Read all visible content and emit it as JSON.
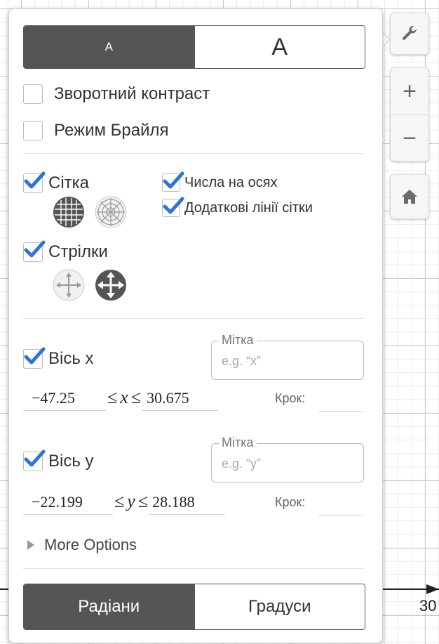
{
  "graph": {
    "x_tick_label": "30"
  },
  "toolbar": {
    "settings_icon": "wrench-icon",
    "zoom_in_label": "+",
    "zoom_out_label": "−",
    "home_icon": "home-icon"
  },
  "settings": {
    "font_size": {
      "small_label": "A",
      "large_label": "A",
      "selected": "small"
    },
    "reverse_contrast": {
      "label": "Зворотний контраст",
      "checked": false
    },
    "braille_mode": {
      "label": "Режим Брайля",
      "checked": false
    },
    "grid": {
      "label": "Сітка",
      "checked": true,
      "options": [
        "rectangular-grid-icon",
        "polar-grid-icon"
      ],
      "selected": "rectangular-grid-icon"
    },
    "axis_numbers": {
      "label": "Числа на осях",
      "checked": true
    },
    "minor_gridlines": {
      "label": "Додаткові лінії сітки",
      "checked": true
    },
    "arrows": {
      "label": "Стрілки",
      "checked": true,
      "options": [
        "arrows-none-icon",
        "arrows-both-icon"
      ],
      "selected": "arrows-both-icon"
    },
    "x_axis": {
      "label": "Вісь x",
      "checked": true,
      "label_field_legend": "Мітка",
      "label_field_placeholder": "e.g. “x”",
      "min": "−47.25",
      "leq": "≤",
      "var": "x",
      "max": "30.675",
      "step_label": "Крок:"
    },
    "y_axis": {
      "label": "Вісь y",
      "checked": true,
      "label_field_legend": "Мітка",
      "label_field_placeholder": "e.g. “y”",
      "min": "−22.199",
      "leq": "≤",
      "var": "y",
      "max": "28.188",
      "step_label": "Крок:"
    },
    "more_options_label": "More Options",
    "angle_mode": {
      "radians_label": "Радіани",
      "degrees_label": "Градуси",
      "selected": "radians"
    }
  },
  "colors": {
    "accent_check": "#2f72d8",
    "selected_segment": "#555555",
    "grid_major": "#c9c9c9",
    "grid_minor": "#ececec"
  }
}
